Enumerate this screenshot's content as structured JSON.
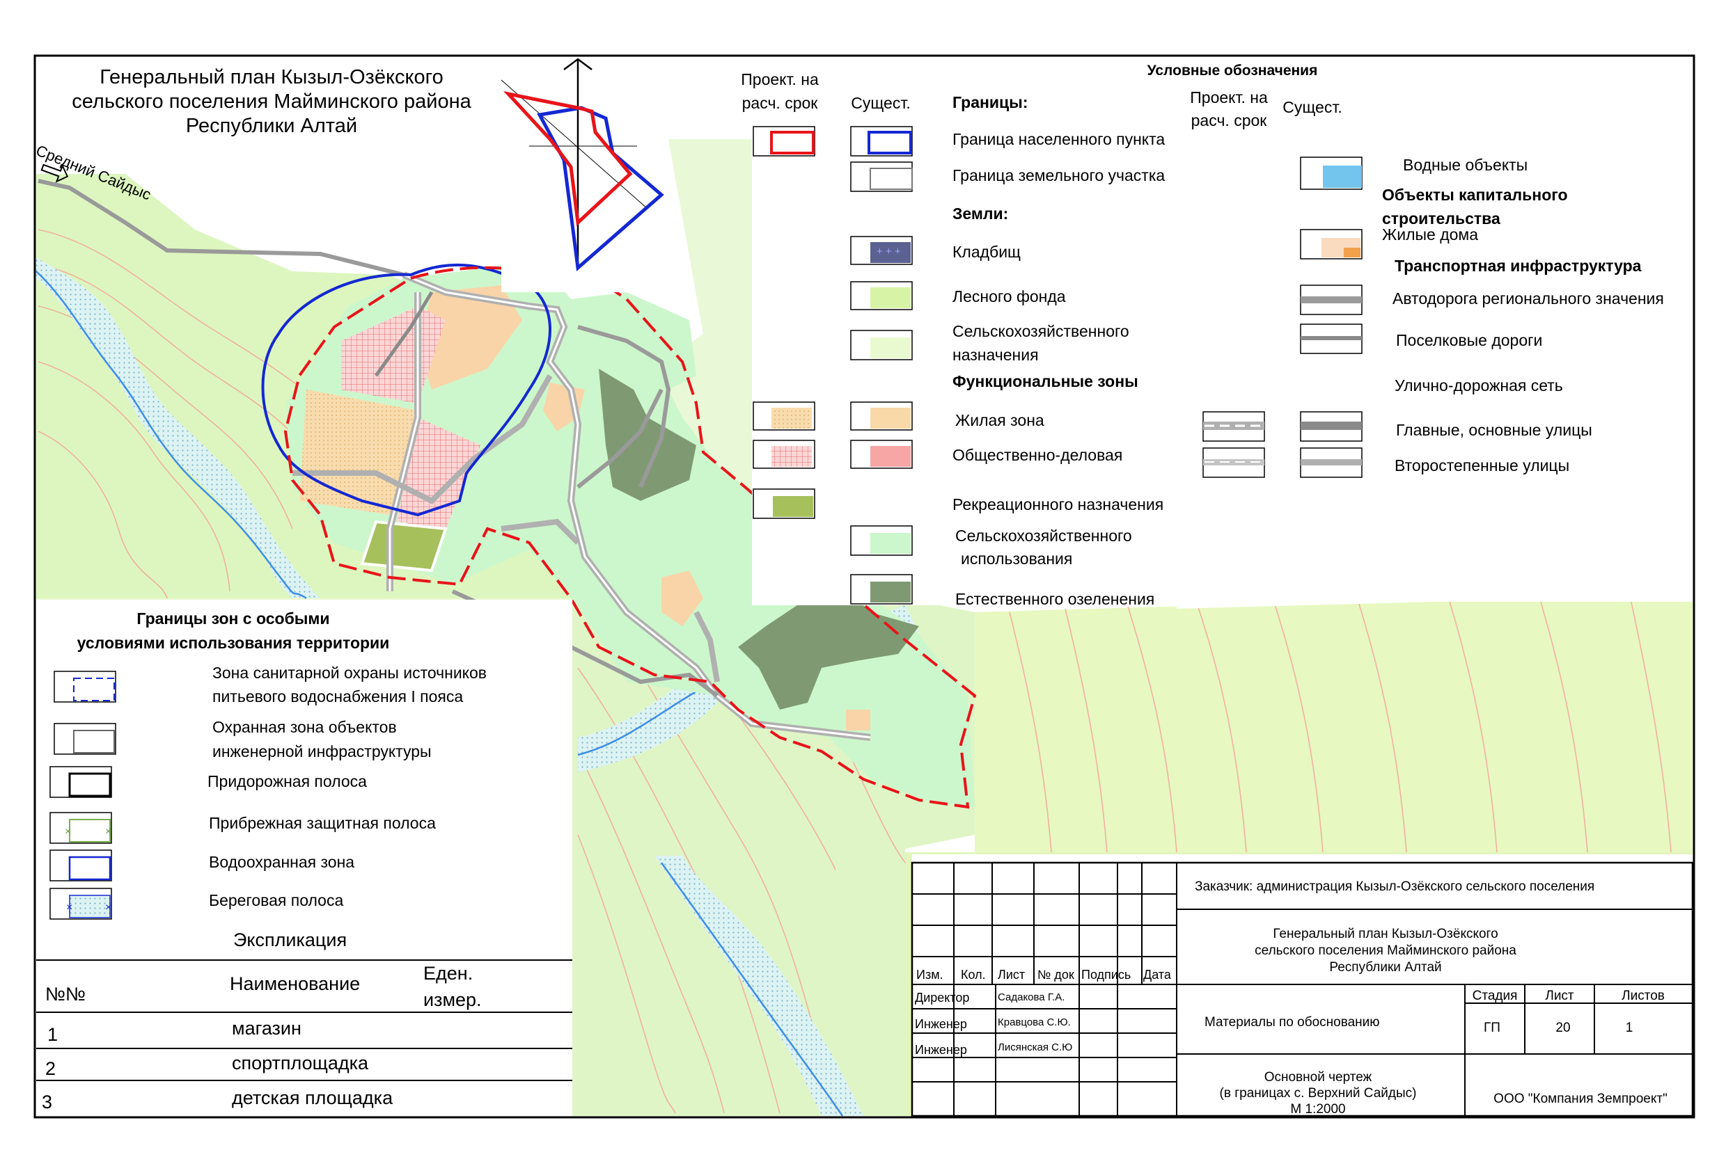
{
  "title": {
    "line1": "Генеральный план  Кызыл-Озёкского",
    "line2": "сельского поселения Майминского района",
    "line3": "Республики Алтай"
  },
  "map_labels": {
    "road_name": "Средний Сайдыс"
  },
  "legend": {
    "heading": "Условные обозначения",
    "col_proj_l1": "Проект. на",
    "col_proj_l2": "расч. срок",
    "col_exist": "Сущест.",
    "col2_proj_l1": "Проект. на",
    "col2_proj_l2": "расч. срок",
    "col2_exist": "Сущест.",
    "sec_borders": "Границы:",
    "border_settlement": "Граница населенного пункта",
    "border_land_plot": "Граница земельного участка",
    "sec_lands": "Земли:",
    "land_cemetery": "Кладбищ",
    "land_forest": "Лесного фонда",
    "land_agri_l1": "Сельскохозяйственного",
    "land_agri_l2": "назначения",
    "sec_zones": "Функциональные зоны",
    "zone_residential": "Жилая зона",
    "zone_public": "Общественно-деловая",
    "zone_recreation": "Рекреационного назначения",
    "zone_agri_use_l1": "Сельскохозяйственного",
    "zone_agri_use_l2": "использования",
    "zone_natural_green": "Естественного озеленения",
    "water_objects": "Водные объекты",
    "sec_capital_l1": "Объекты капитального",
    "sec_capital_l2": "строительства",
    "residential_houses": "Жилые дома",
    "sec_transport": "Транспортная инфраструктура",
    "regional_road": "Автодорога регионального значения",
    "village_roads": "Поселковые дороги",
    "street_network": "Улично-дорожная сеть",
    "main_streets": "Главные, основные улицы",
    "secondary_streets": "Второстепенные улицы"
  },
  "special_zones": {
    "heading_l1": "Границы зон с особыми",
    "heading_l2": "условиями использования территории",
    "sanitary_l1": "Зона санитарной охраны источников",
    "sanitary_l2": "питьевого водоснабжения I пояса",
    "engineering_l1": "Охранная зона объектов",
    "engineering_l2": "инженерной инфраструктуры",
    "roadside": "Придорожная полоса",
    "coastal_protective": "Прибрежная защитная полоса",
    "water_protection": "Водоохранная зона",
    "shore_strip": "Береговая полоса"
  },
  "explication": {
    "title": "Экспликация",
    "col_no": "№№",
    "col_name": "Наименование",
    "col_unit_l1": "Еден.",
    "col_unit_l2": "измер.",
    "rows": [
      {
        "no": "1",
        "name": "магазин"
      },
      {
        "no": "2",
        "name": "спортплощадка"
      },
      {
        "no": "3",
        "name": "детская площадка"
      }
    ]
  },
  "stamp": {
    "customer": "Заказчик: администрация Кызыл-Озёкского сельского поселения",
    "project_l1": "Генеральный план  Кызыл-Озёкского",
    "project_l2": "сельского поселения Майминского района",
    "project_l3": "Республики Алтай",
    "h_izm": "Изм.",
    "h_kol": "Кол.",
    "h_list": "Лист",
    "h_doc": "№ док",
    "h_sign": "Подпись",
    "h_date": "Дата",
    "role_director": "Директор",
    "role_engineer1": "Инженер",
    "role_engineer2": "Инженер",
    "name_director": "Садакова Г.А.",
    "name_engineer1": "Кравцова С.Ю.",
    "name_engineer2": "Лисянская С.Ю",
    "materials": "Материалы по обоснованию",
    "h_stage": "Стадия",
    "h_sheet": "Лист",
    "h_sheets": "Листов",
    "stage": "ГП",
    "sheet": "20",
    "sheets": "1",
    "drawing_l1": "Основной чертеж",
    "drawing_l2": "(в границах с. Верхний Сайдыс)",
    "scale": "М 1:2000",
    "company": "ООО \"Компания Земпроект\""
  },
  "colors": {
    "projected_border": "#e8141a",
    "existing_border": "#1428d2",
    "residential_zone": "#f9d9a8",
    "public_zone": "#f7a5a5",
    "recreation_zone": "#a6c05c",
    "agri_use_zone": "#ccf7cc",
    "natural_green": "#7f9a72",
    "forest_fund": "#d7f4a6",
    "agri_land": "#eafad0",
    "water": "#73c5ee",
    "houses": "#f7c597",
    "road": "#a0a0a0"
  }
}
